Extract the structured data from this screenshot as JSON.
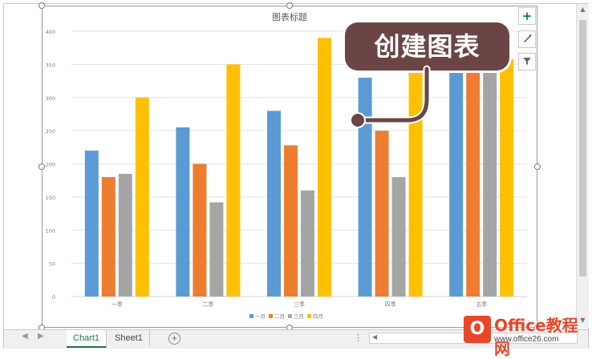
{
  "chart_data": {
    "type": "bar",
    "title": "图表标题",
    "categories": [
      "一季",
      "二季",
      "三季",
      "四季",
      "五季"
    ],
    "series": [
      {
        "name": "一月",
        "color": "#5b9bd5",
        "values": [
          220,
          255,
          280,
          330,
          370
        ]
      },
      {
        "name": "二月",
        "color": "#ed7d31",
        "values": [
          180,
          200,
          228,
          250,
          360
        ]
      },
      {
        "name": "三月",
        "color": "#a5a5a5",
        "values": [
          185,
          142,
          160,
          180,
          345
        ]
      },
      {
        "name": "四月",
        "color": "#ffc000",
        "values": [
          300,
          350,
          390,
          360,
          358
        ]
      }
    ],
    "ylim": [
      0,
      400
    ],
    "yticks": [
      0,
      50,
      100,
      150,
      200,
      250,
      300,
      350,
      400
    ],
    "grid": true,
    "legend_position": "bottom"
  },
  "side_buttons": [
    {
      "name": "add-chart-element-icon",
      "glyph": "+"
    },
    {
      "name": "chart-styles-brush-icon",
      "glyph": "🖌"
    },
    {
      "name": "chart-filter-icon",
      "glyph": "⏷"
    }
  ],
  "callout": {
    "text": "创建图表",
    "color": "#6b4545"
  },
  "tabs": {
    "chart1": "Chart1",
    "sheet1": "Sheet1"
  },
  "watermark": {
    "brand": "Office教程网",
    "url": "www.office26.com",
    "logo": "O"
  }
}
